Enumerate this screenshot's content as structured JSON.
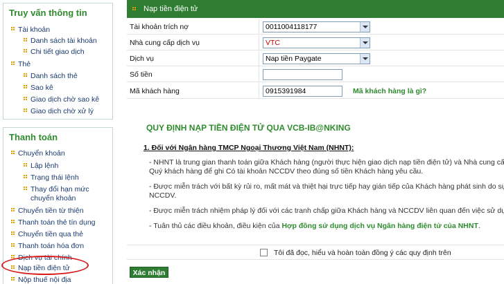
{
  "sidebar": {
    "panel1": {
      "title": "Truy vấn thông tin",
      "items": [
        {
          "label": "Tài khoản",
          "level": 0
        },
        {
          "label": "Danh sách tài khoản",
          "level": 1
        },
        {
          "label": "Chi tiết giao dịch",
          "level": 1
        },
        {
          "label": "Thẻ",
          "level": 0
        },
        {
          "label": "Danh sách thẻ",
          "level": 1
        },
        {
          "label": "Sao kê",
          "level": 1
        },
        {
          "label": "Giao dịch chờ sao kê",
          "level": 1
        },
        {
          "label": "Giao dịch chờ xử lý",
          "level": 1
        }
      ]
    },
    "panel2": {
      "title": "Thanh toán",
      "items": [
        {
          "label": "Chuyển khoản",
          "level": 0
        },
        {
          "label": "Lập lệnh",
          "level": 1
        },
        {
          "label": "Trạng thái lệnh",
          "level": 1
        },
        {
          "label": "Thay đổi hạn mức",
          "level": 1
        },
        {
          "label": "chuyển khoản",
          "level": 1
        },
        {
          "label": "Chuyển tiền từ thiện",
          "level": 0
        },
        {
          "label": "Thanh toán thẻ tín dụng",
          "level": 0
        },
        {
          "label": "Chuyển tiền qua thẻ",
          "level": 0
        },
        {
          "label": "Thanh toán hóa đơn",
          "level": 0
        },
        {
          "label": "Dịch vụ tài chính",
          "level": 0
        },
        {
          "label": "Nạp tiền điện tử",
          "level": 0
        },
        {
          "label": "Nộp thuế nội địa",
          "level": 0
        }
      ]
    }
  },
  "main": {
    "header_title": "Nạp tiền điện tử",
    "form": {
      "account_label": "Tài khoản trích nợ",
      "account_value": "0011004118177",
      "provider_label": "Nhà cung cấp dịch vụ",
      "provider_value": "VTC",
      "service_label": "Dịch vụ",
      "service_value": "Nap tiền Paygate",
      "amount_label": "Số tiền",
      "amount_value": "",
      "customer_label": "Mã khách hàng",
      "customer_value": "0915391984",
      "customer_help": "Mã khách hàng là gì?"
    },
    "rules": {
      "title": "QUY ĐỊNH NẠP TIỀN ĐIỆN TỬ QUA VCB-IB@NKING",
      "subtitle": "1. Đối với Ngân hàng TMCP Ngoại Thương Việt Nam (NHNT):",
      "line1a": "- NHNT là trung gian thanh toán giữa Khách hàng (người thực hiện giao dịch nạp tiền điện tử) và Nhà cung cấp dịch v",
      "line1b": "Quý khách hàng để ghi Có tài khoản NCCDV theo đúng số tiền Khách hàng yêu cầu.",
      "line2a": "- Được miễn trách với bất kỳ rủi ro, mất mát và thiệt hại trực tiếp hay gián tiếp của Khách hàng phát sinh do sự chậm",
      "line2b": "NCCDV.",
      "line3": "- Được miễn trách nhiệm pháp lý đối với các tranh chấp giữa Khách hàng và NCCDV liên quan đến việc sử dụng dịch",
      "line4_prefix": "- Tuân thủ các điều khoản, điều kiện của ",
      "line4_link": "Hợp đồng sử dụng dịch vụ Ngân hàng điện tử của NHNT",
      "line4_suffix": "."
    },
    "agree_label": "Tôi đã đọc, hiểu và hoàn toàn đồng ý các quy định trên",
    "confirm_label": "Xác nhận"
  },
  "colors": {
    "brand_green": "#2e7d32",
    "title_green": "#2e8b2e",
    "highlight_red": "#d61c1c",
    "provider_text": "#cc0000"
  },
  "icons": [
    "bullet-icon",
    "chevron-down-icon",
    "checkbox-icon"
  ]
}
